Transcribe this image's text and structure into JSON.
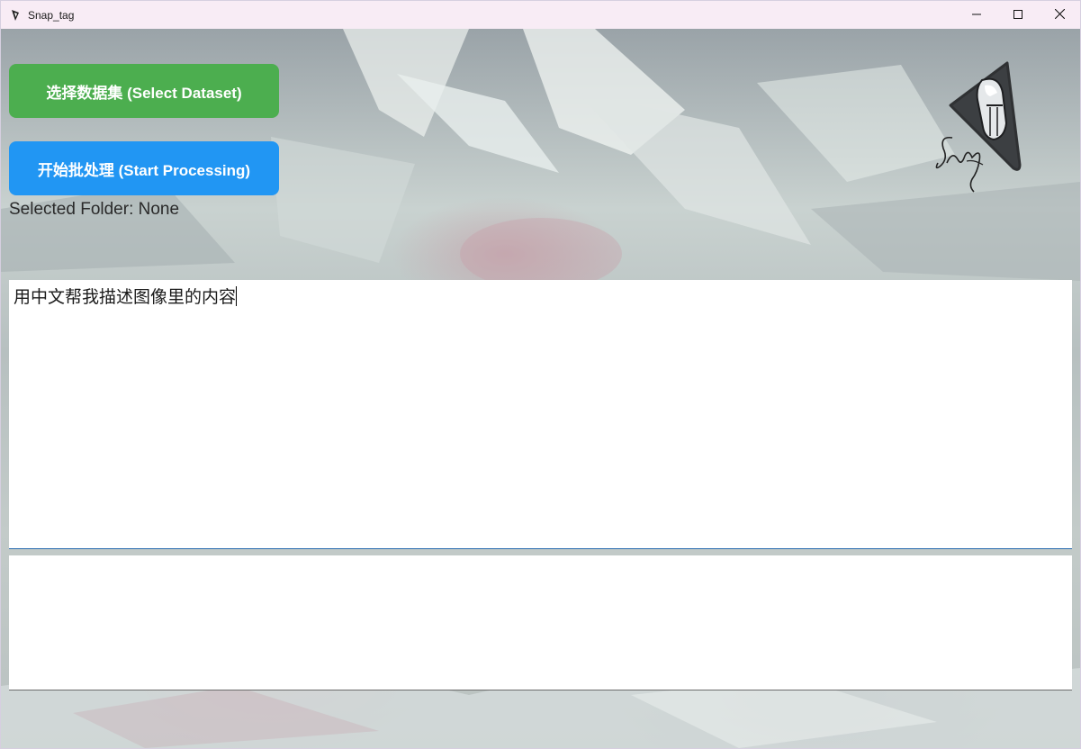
{
  "window": {
    "title": "Snap_tag"
  },
  "icons": {
    "app": "app-icon",
    "minimize": "minimize-icon",
    "maximize": "maximize-icon",
    "close": "close-icon",
    "logo": "snap-logo-icon"
  },
  "buttons": {
    "select_dataset": "选择数据集 (Select Dataset)",
    "start_processing": "开始批处理 (Start Processing)"
  },
  "folder": {
    "label": "Selected Folder: None"
  },
  "prompt": {
    "value": "用中文帮我描述图像里的内容"
  },
  "output": {
    "value": ""
  },
  "colors": {
    "select_button": "#4cae4f",
    "start_button": "#2196f3",
    "titlebar": "#f8ecf5"
  }
}
